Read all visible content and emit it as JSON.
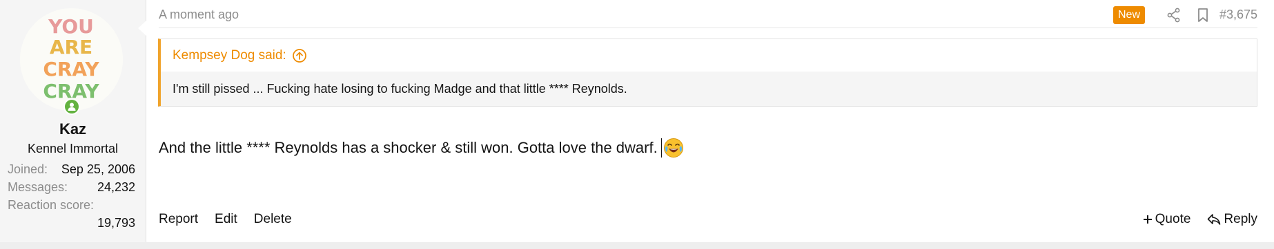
{
  "user": {
    "avatar_text": [
      "YOU",
      "ARE",
      "CRAY",
      "CRAY"
    ],
    "name": "Kaz",
    "title": "Kennel Immortal",
    "stats": {
      "joined_label": "Joined:",
      "joined_value": "Sep 25, 2006",
      "messages_label": "Messages:",
      "messages_value": "24,232",
      "reaction_label": "Reaction score:",
      "reaction_value": "19,793"
    },
    "online_icon": "user-online-icon"
  },
  "post": {
    "time": "A moment ago",
    "badge": "New",
    "number": "#3,675",
    "quote": {
      "author_label": "Kempsey Dog said:",
      "text": "I'm still pissed ... Fucking hate losing to fucking Madge and that little **** Reynolds."
    },
    "message": "And the little **** Reynolds has a shocker & still won. Gotta love the dwarf.",
    "emoji": "😂",
    "actions": {
      "report": "Report",
      "edit": "Edit",
      "delete": "Delete",
      "quote": "Quote",
      "reply": "Reply"
    }
  },
  "colors": {
    "accent": "#ee8b00",
    "online": "#63b240",
    "quote_border": "#f0a32b"
  },
  "icons": [
    "share-icon",
    "bookmark-icon",
    "quote-arrow-up-icon",
    "plus-icon",
    "reply-icon",
    "laughing-emoji-icon"
  ]
}
